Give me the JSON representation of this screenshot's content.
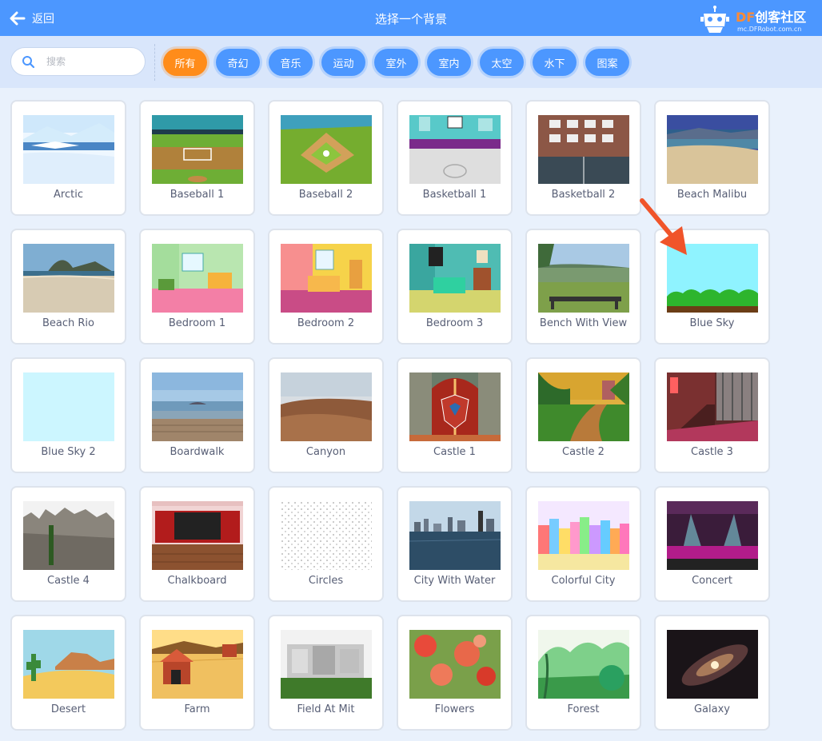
{
  "header": {
    "back_label": "返回",
    "title": "选择一个背景"
  },
  "logo": {
    "brand_df": "DF",
    "brand_cn": "创客社区",
    "sub": "mc.DFRobot.com.cn"
  },
  "search": {
    "placeholder": "搜索",
    "value": ""
  },
  "tags": [
    {
      "label": "所有",
      "active": true
    },
    {
      "label": "奇幻"
    },
    {
      "label": "音乐"
    },
    {
      "label": "运动"
    },
    {
      "label": "室外"
    },
    {
      "label": "室内"
    },
    {
      "label": "太空"
    },
    {
      "label": "水下"
    },
    {
      "label": "图案"
    }
  ],
  "colors": {
    "header": "#4c97ff",
    "active_tag": "#ff8c1a",
    "arrow": "#f0542a"
  },
  "backdrops": [
    {
      "name": "Arctic",
      "icon": "arctic-thumbnail"
    },
    {
      "name": "Baseball 1",
      "icon": "baseball-1-thumbnail"
    },
    {
      "name": "Baseball 2",
      "icon": "baseball-2-thumbnail"
    },
    {
      "name": "Basketball 1",
      "icon": "basketball-1-thumbnail"
    },
    {
      "name": "Basketball 2",
      "icon": "basketball-2-thumbnail"
    },
    {
      "name": "Beach Malibu",
      "icon": "beach-malibu-thumbnail"
    },
    {
      "name": "Beach Rio",
      "icon": "beach-rio-thumbnail"
    },
    {
      "name": "Bedroom 1",
      "icon": "bedroom-1-thumbnail"
    },
    {
      "name": "Bedroom 2",
      "icon": "bedroom-2-thumbnail"
    },
    {
      "name": "Bedroom 3",
      "icon": "bedroom-3-thumbnail"
    },
    {
      "name": "Bench With View",
      "icon": "bench-with-view-thumbnail"
    },
    {
      "name": "Blue Sky",
      "icon": "blue-sky-thumbnail"
    },
    {
      "name": "Blue Sky 2",
      "icon": "blue-sky-2-thumbnail"
    },
    {
      "name": "Boardwalk",
      "icon": "boardwalk-thumbnail"
    },
    {
      "name": "Canyon",
      "icon": "canyon-thumbnail"
    },
    {
      "name": "Castle 1",
      "icon": "castle-1-thumbnail"
    },
    {
      "name": "Castle 2",
      "icon": "castle-2-thumbnail"
    },
    {
      "name": "Castle 3",
      "icon": "castle-3-thumbnail"
    },
    {
      "name": "Castle 4",
      "icon": "castle-4-thumbnail"
    },
    {
      "name": "Chalkboard",
      "icon": "chalkboard-thumbnail"
    },
    {
      "name": "Circles",
      "icon": "circles-thumbnail"
    },
    {
      "name": "City With Water",
      "icon": "city-with-water-thumbnail"
    },
    {
      "name": "Colorful City",
      "icon": "colorful-city-thumbnail"
    },
    {
      "name": "Concert",
      "icon": "concert-thumbnail"
    },
    {
      "name": "Desert",
      "icon": "desert-thumbnail"
    },
    {
      "name": "Farm",
      "icon": "farm-thumbnail"
    },
    {
      "name": "Field At Mit",
      "icon": "field-at-mit-thumbnail"
    },
    {
      "name": "Flowers",
      "icon": "flowers-thumbnail"
    },
    {
      "name": "Forest",
      "icon": "forest-thumbnail"
    },
    {
      "name": "Galaxy",
      "icon": "galaxy-thumbnail"
    }
  ]
}
